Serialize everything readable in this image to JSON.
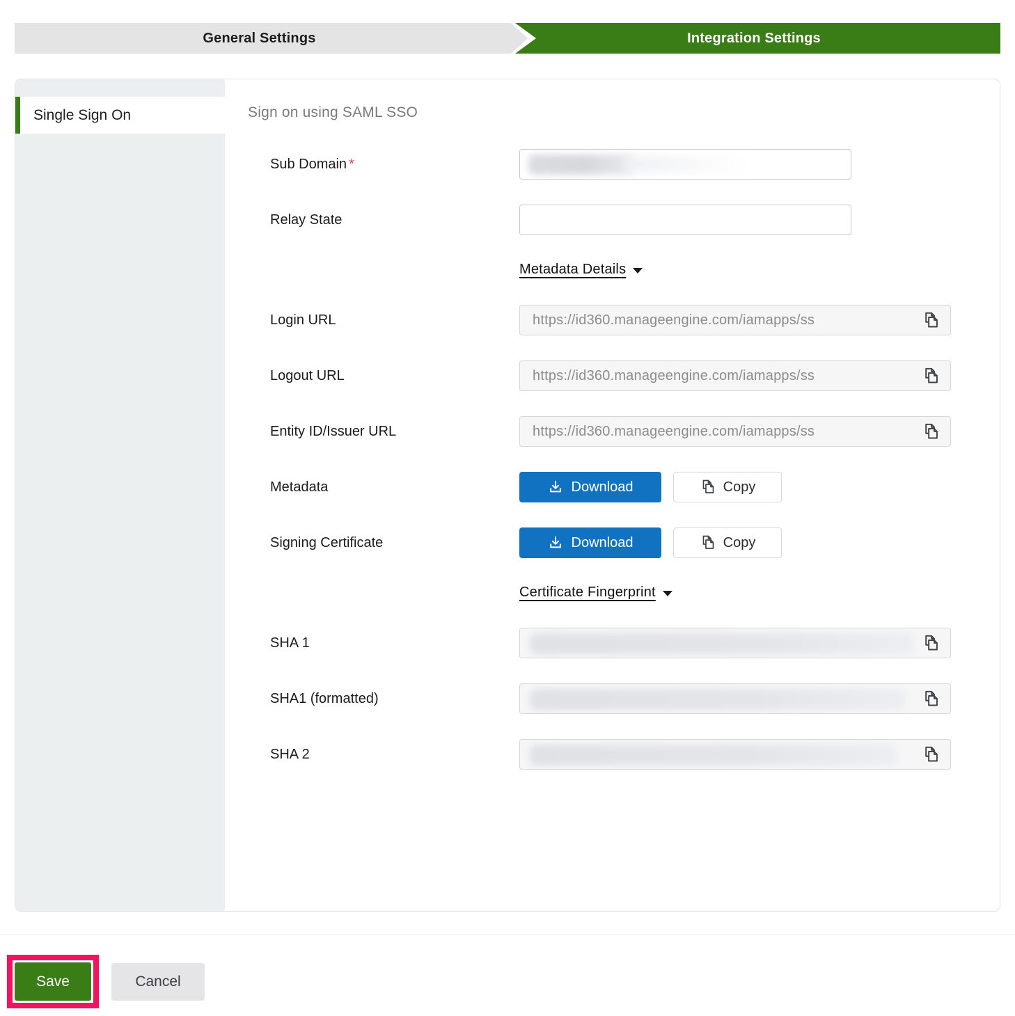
{
  "tabs": {
    "general": {
      "label": "General Settings"
    },
    "integration": {
      "label": "Integration Settings",
      "active": true
    }
  },
  "sidebar": {
    "single_sign_on": {
      "label": "Single Sign On",
      "active": true
    }
  },
  "content": {
    "heading": "Sign on using SAML SSO",
    "labels": {
      "sub_domain": "Sub Domain",
      "required_marker": "*",
      "relay_state": "Relay State",
      "metadata_details": "Metadata Details ",
      "login_url": "Login URL",
      "logout_url": "Logout URL",
      "entity_id": "Entity ID/Issuer URL",
      "metadata": "Metadata",
      "signing_certificate": "Signing Certificate",
      "certificate_fingerprint": "Certificate Fingerprint ",
      "sha1": "SHA 1",
      "sha1_formatted": "SHA1 (formatted)",
      "sha2": "SHA 2"
    },
    "fields": {
      "sub_domain": {
        "value_masked": true
      },
      "relay_state": {
        "value": ""
      },
      "login_url": {
        "value": "https://id360.manageengine.com/iamapps/ss",
        "readonly": true
      },
      "logout_url": {
        "value": "https://id360.manageengine.com/iamapps/ss",
        "readonly": true
      },
      "entity_id": {
        "value": "https://id360.manageengine.com/iamapps/ss",
        "readonly": true
      },
      "sha1": {
        "value_masked": true,
        "readonly": true
      },
      "sha1_formatted": {
        "value_masked": true,
        "readonly": true
      },
      "sha2": {
        "value_masked": true,
        "readonly": true
      }
    },
    "buttons": {
      "download": "Download",
      "copy": "Copy"
    }
  },
  "footer": {
    "save": "Save",
    "cancel": "Cancel"
  },
  "colors": {
    "accent_green": "#3a7d17",
    "primary_blue": "#1172c2",
    "annotation_pink": "#f3135f",
    "required_red": "#d24848",
    "sidebar_bg": "#eceff0",
    "inactive_tab_bg": "#e4e4e5"
  },
  "icons": [
    "download-icon",
    "copy-icon",
    "chevron-down-icon",
    "step-arrow"
  ]
}
